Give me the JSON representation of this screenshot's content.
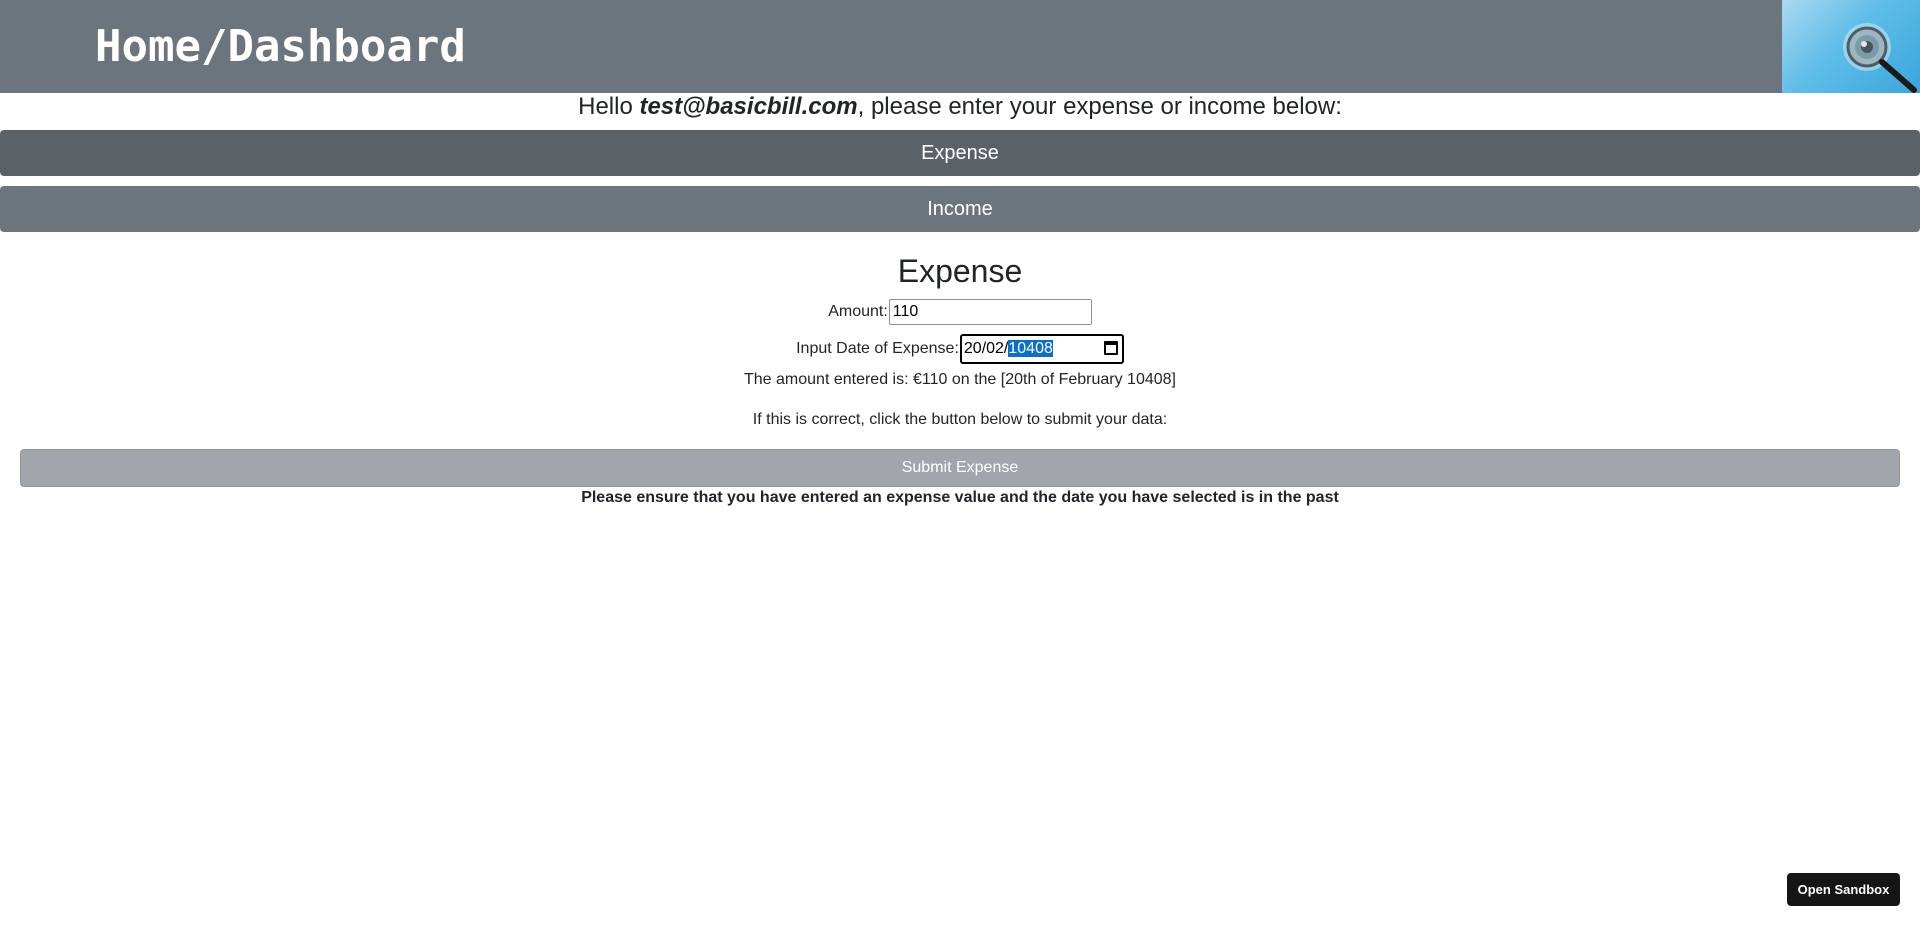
{
  "header": {
    "title": "Home/Dashboard",
    "logo_icon": "magnifying-glass-icon"
  },
  "greeting": {
    "prefix": "Hello ",
    "email": "test@basicbill.com",
    "suffix": ", please enter your expense or income below:"
  },
  "tabs": {
    "expense_label": "Expense",
    "income_label": "Income"
  },
  "form": {
    "section_title": "Expense",
    "amount_label": "Amount:",
    "amount_value": "110",
    "date_label": "Input Date of Expense:",
    "date_day_month": "20/02/",
    "date_year": "10408",
    "date_icon": "calendar-icon",
    "summary_text": "The amount entered is: €110 on the [20th of February 10408]",
    "confirm_text": "If this is correct, click the button below to submit your data:",
    "submit_label": "Submit Expense",
    "warning_text": "Please ensure that you have entered an expense value and the date you have selected is in the past"
  },
  "sandbox": {
    "label": "Open Sandbox"
  },
  "colors": {
    "header_bg": "#6c757d",
    "tab_expense_bg": "#5a6268",
    "tab_income_bg": "#6c757d",
    "submit_bg": "#a1a6ad",
    "date_selection": "#0a6ed1"
  }
}
